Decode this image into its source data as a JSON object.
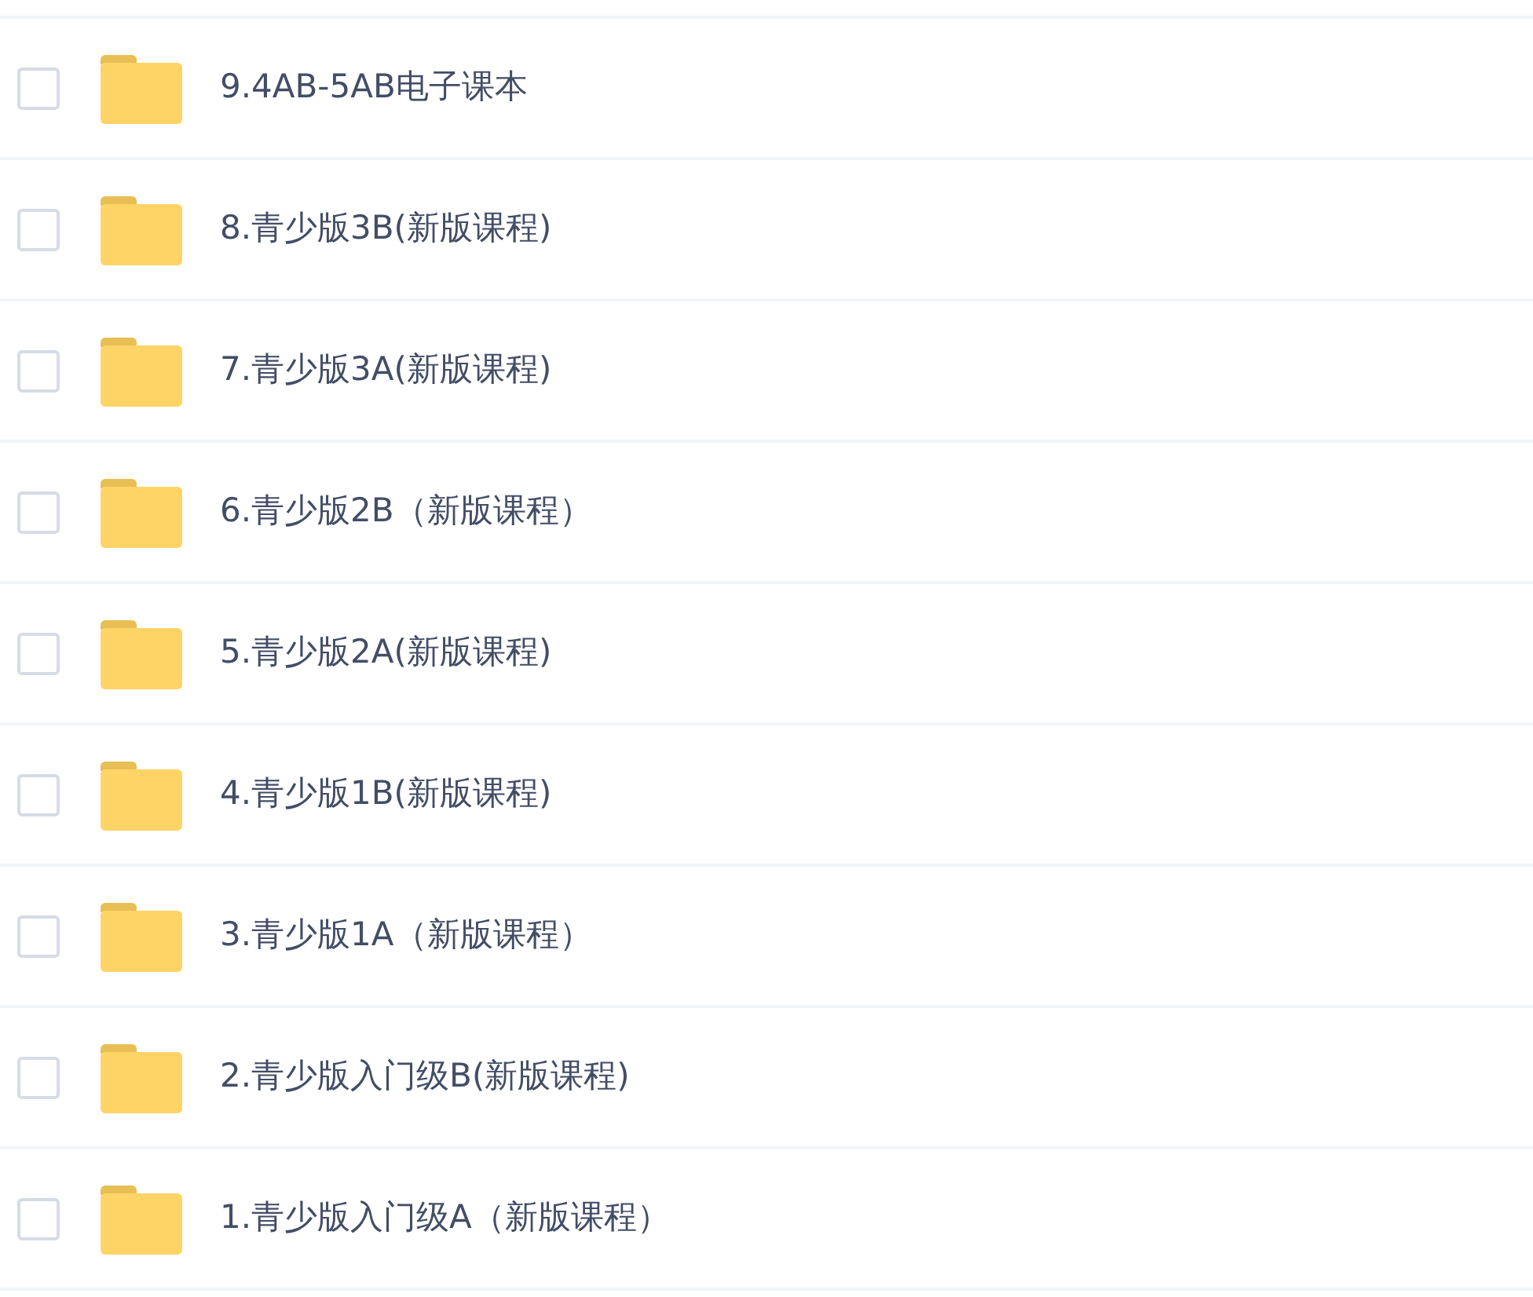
{
  "files": [
    {
      "name": "9.4AB-5AB电子课本",
      "checked": false
    },
    {
      "name": "8.青少版3B(新版课程)",
      "checked": false
    },
    {
      "name": "7.青少版3A(新版课程)",
      "checked": false
    },
    {
      "name": "6.青少版2B（新版课程）",
      "checked": false
    },
    {
      "name": "5.青少版2A(新版课程)",
      "checked": false
    },
    {
      "name": "4.青少版1B(新版课程)",
      "checked": false
    },
    {
      "name": "3.青少版1A（新版课程）",
      "checked": false
    },
    {
      "name": "2.青少版入门级B(新版课程)",
      "checked": false
    },
    {
      "name": "1.青少版入门级A（新版课程）",
      "checked": false
    }
  ]
}
